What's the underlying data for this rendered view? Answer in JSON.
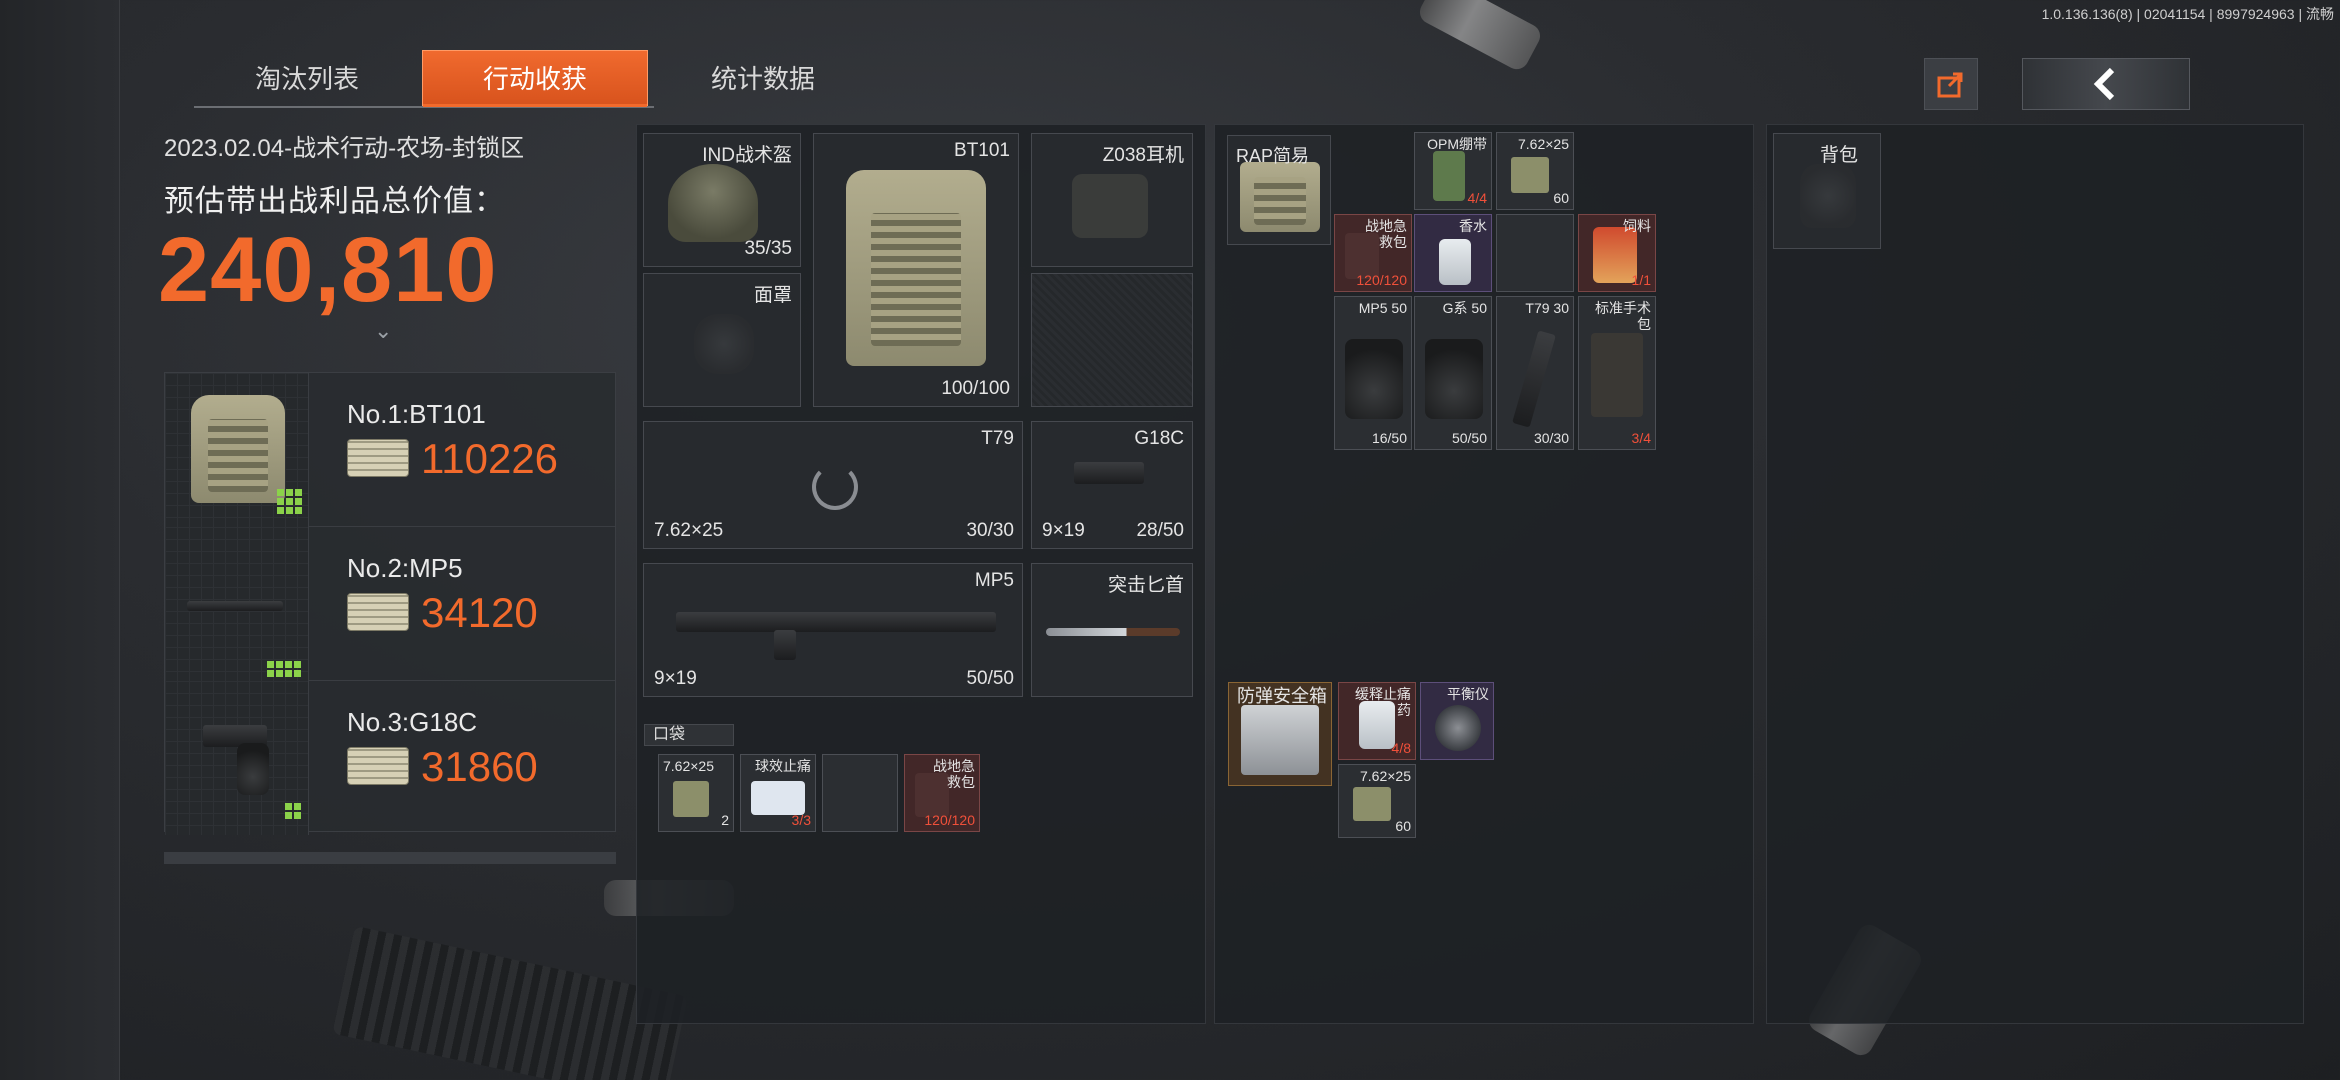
{
  "status_bar": "1.0.136.136(8) | 02041154 | 8997924963 | 流畅",
  "tabs": [
    {
      "label": "淘汰列表",
      "active": false
    },
    {
      "label": "行动收获",
      "active": true
    },
    {
      "label": "统计数据",
      "active": false
    }
  ],
  "header": {
    "share_icon": "share-icon",
    "back_icon": "chevron-left-icon"
  },
  "summary": {
    "date_line": "2023.02.04-战术行动-农场-封锁区",
    "estimate_label": "预估带出战利品总价值：",
    "total_value": "240,810",
    "expand_glyph": "⌄"
  },
  "ranking": [
    {
      "name": "No.1:BT101",
      "value": "110226"
    },
    {
      "name": "No.2:MP5",
      "value": "34120"
    },
    {
      "name": "No.3:G18C",
      "value": "31860"
    }
  ],
  "equipment": {
    "helmet": {
      "label": "IND战术盔",
      "count": "35/35"
    },
    "armor": {
      "label": "BT101",
      "count": "100/100"
    },
    "headset": {
      "label": "Z038耳机"
    },
    "face": {
      "label": "面罩"
    },
    "primary": {
      "label": "T79",
      "ammo": "7.62×25",
      "count": "30/30"
    },
    "pistol": {
      "label": "G18C",
      "ammo": "9×19",
      "count": "28/50"
    },
    "secondary": {
      "label": "MP5",
      "ammo": "9×19",
      "count": "50/50"
    },
    "melee": {
      "label": "突击匕首"
    },
    "pocket_label": "口袋",
    "pocket": [
      {
        "label": "7.62×25",
        "count": "2",
        "color": "#4c4f55"
      },
      {
        "label": "球效止痛",
        "count": "3/3",
        "count_red": true
      },
      {
        "label": "",
        "count": ""
      },
      {
        "label": "战地急救包",
        "count": "120/120",
        "count_red": true
      }
    ]
  },
  "rig": {
    "label": "RAP简易",
    "items": [
      {
        "label": "OPM绷带",
        "count": "4/4",
        "red": true
      },
      {
        "label": "7.62×25",
        "count": "60"
      },
      {
        "label": "战地急救包",
        "count": "120/120",
        "red": true
      },
      {
        "label": "香水",
        "count": ""
      },
      {
        "label": "",
        "count": ""
      },
      {
        "label": "饲料",
        "count": "1/1",
        "red": true
      },
      {
        "label": "MP5 50",
        "count": "16/50"
      },
      {
        "label": "G系 50",
        "count": "50/50"
      },
      {
        "label": "T79 30",
        "count": "30/30"
      },
      {
        "label": "标准手术包",
        "count": "3/4",
        "red": true
      }
    ]
  },
  "safe_box": {
    "label": "防弹安全箱",
    "items": [
      {
        "label": "缓释止痛药",
        "count": "4/8",
        "red": true
      },
      {
        "label": "平衡仪",
        "count": ""
      },
      {
        "label": "7.62×25",
        "count": "60"
      }
    ]
  },
  "backpack": {
    "label": "背包"
  }
}
